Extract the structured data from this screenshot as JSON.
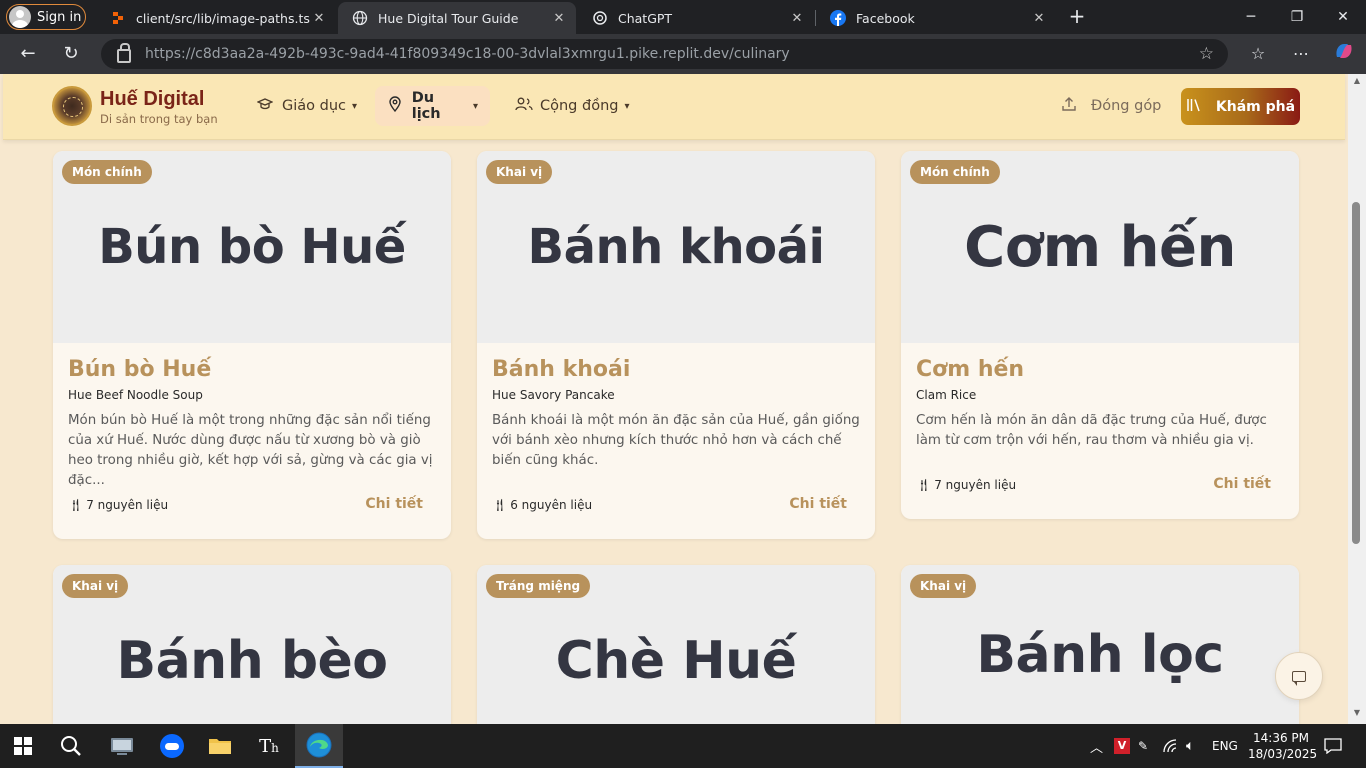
{
  "browser": {
    "signin_label": "Sign in",
    "tabs": [
      {
        "title": "client/src/lib/image-paths.ts - Hu"
      },
      {
        "title": "Hue Digital Tour Guide"
      },
      {
        "title": "ChatGPT"
      },
      {
        "title": "Facebook"
      }
    ],
    "url_host": "https://c8d3aa2a-492b-493c-9ad4-41f809349c18-00-3dvlal3xmrgu1.pike.replit.dev",
    "url_path": "/culinary"
  },
  "site": {
    "brand_title": "Huế Digital",
    "brand_subtitle": "Di sản trong tay bạn",
    "nav": [
      {
        "label": "Giáo dục",
        "icon": "graduation-cap-icon"
      },
      {
        "label": "Du lịch",
        "icon": "map-pin-icon",
        "active": true
      },
      {
        "label": "Cộng đồng",
        "icon": "users-icon"
      }
    ],
    "contribute_label": "Đóng góp",
    "explore_label": "Khám phá",
    "colors": {
      "header_bg": "#fae7b5",
      "brand": "#7a2418",
      "accent": "#b8925c",
      "page_bg": "#f7e8cf"
    }
  },
  "cards": [
    {
      "badge": "Món chính",
      "image_text": "Bún bò Huế",
      "name": "Bún bò Huế",
      "english": "Hue Beef Noodle Soup",
      "description": "Món bún bò Huế là một trong những đặc sản nổi tiếng của xứ Huế. Nước dùng được nấu từ xương bò và giò heo trong nhiều giờ, kết hợp với sả, gừng và các gia vị đặc...",
      "ingredients": "7 nguyên liệu",
      "detail": "Chi tiết"
    },
    {
      "badge": "Khai vị",
      "image_text": "Bánh khoái",
      "name": "Bánh khoái",
      "english": "Hue Savory Pancake",
      "description": "Bánh khoái là một món ăn đặc sản của Huế, gần giống với bánh xèo nhưng kích thước nhỏ hơn và cách chế biến cũng khác.",
      "ingredients": "6 nguyên liệu",
      "detail": "Chi tiết"
    },
    {
      "badge": "Món chính",
      "image_text": "Cơm hến",
      "name": "Cơm hến",
      "english": "Clam Rice",
      "description": "Cơm hến là món ăn dân dã đặc trưng của Huế, được làm từ cơm trộn với hến, rau thơm và nhiều gia vị.",
      "ingredients": "7 nguyên liệu",
      "detail": "Chi tiết"
    },
    {
      "badge": "Khai vị",
      "image_text": "Bánh bèo"
    },
    {
      "badge": "Tráng miệng",
      "image_text": "Chè Huế"
    },
    {
      "badge": "Khai vị",
      "image_text": "Bánh lọc"
    }
  ],
  "taskbar": {
    "lang": "ENG",
    "time": "14:36 PM",
    "date": "18/03/2025"
  }
}
